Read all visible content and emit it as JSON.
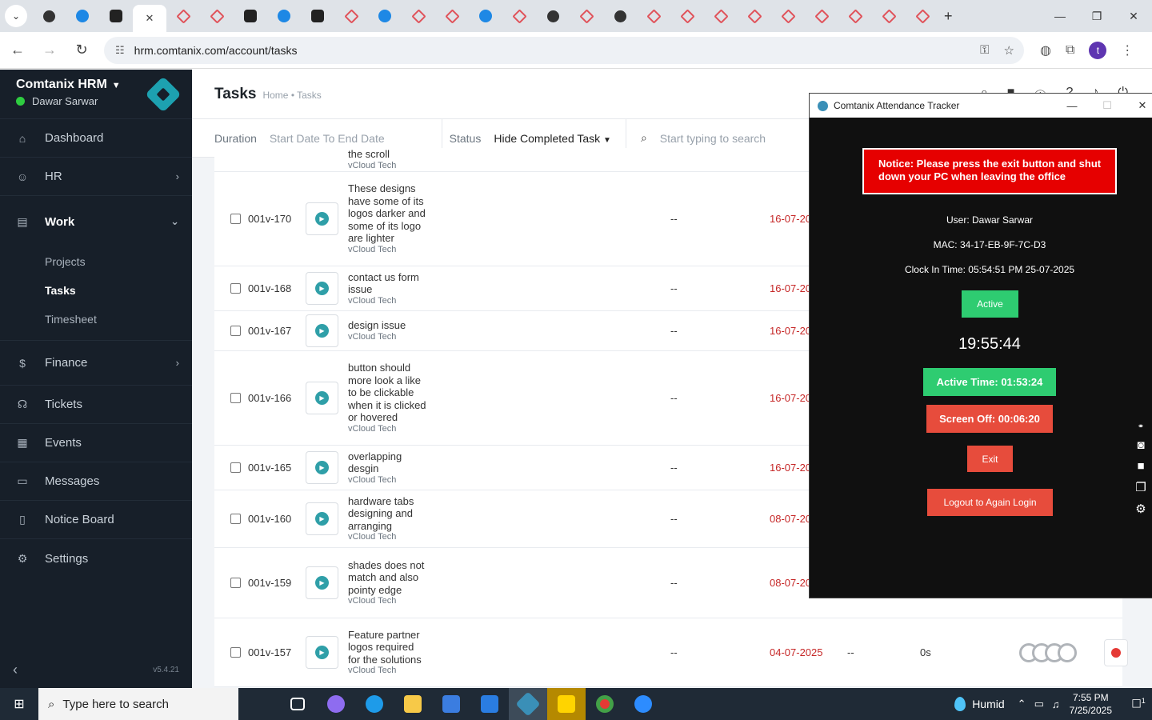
{
  "browser": {
    "url": "hrm.comtanix.com/account/tasks",
    "new_tab": "+",
    "profile_initial": "t"
  },
  "sidebar": {
    "brand": "Comtanix HRM",
    "user": "Dawar Sarwar",
    "version": "v5.4.21",
    "items": [
      {
        "label": "Dashboard"
      },
      {
        "label": "HR"
      },
      {
        "label": "Work"
      },
      {
        "label": "Finance"
      },
      {
        "label": "Tickets"
      },
      {
        "label": "Events"
      },
      {
        "label": "Messages"
      },
      {
        "label": "Notice Board"
      },
      {
        "label": "Settings"
      }
    ],
    "work_sub": [
      "Projects",
      "Tasks",
      "Timesheet"
    ]
  },
  "page": {
    "title": "Tasks",
    "breadcrumb": "Home • Tasks"
  },
  "filters": {
    "duration_label": "Duration",
    "duration_value": "Start Date To End Date",
    "status_label": "Status",
    "status_value": "Hide Completed Task",
    "search_placeholder": "Start typing to search"
  },
  "tasks": [
    {
      "id": "",
      "name": "the scroll",
      "client": "vCloud Tech",
      "h": 30,
      "partial": true
    },
    {
      "id": "001v-170",
      "name": "These designs have some of its logos darker and some of its logo are lighter",
      "client": "vCloud Tech",
      "dash": "--",
      "date": "16-07-20",
      "h": 118
    },
    {
      "id": "001v-168",
      "name": "contact us form issue",
      "client": "vCloud Tech",
      "dash": "--",
      "date": "16-07-20",
      "h": 56
    },
    {
      "id": "001v-167",
      "name": "design issue",
      "client": "vCloud Tech",
      "dash": "--",
      "date": "16-07-20",
      "h": 50
    },
    {
      "id": "001v-166",
      "name": "button should more look a like to be clickable when it is clicked or hovered",
      "client": "vCloud Tech",
      "dash": "--",
      "date": "16-07-20",
      "h": 118
    },
    {
      "id": "001v-165",
      "name": "overlapping desgin",
      "client": "vCloud Tech",
      "dash": "--",
      "date": "16-07-20",
      "h": 56
    },
    {
      "id": "001v-160",
      "name": "hardware tabs designing and arranging",
      "client": "vCloud Tech",
      "dash": "--",
      "date": "08-07-20",
      "h": 72
    },
    {
      "id": "001v-159",
      "name": "shades does not match and also pointy edge",
      "client": "vCloud Tech",
      "dash": "--",
      "date": "08-07-20",
      "h": 88
    },
    {
      "id": "001v-157",
      "name": "Feature partner logos required for the solutions",
      "client": "vCloud Tech",
      "dash": "--",
      "date": "04-07-2025",
      "dash2": "--",
      "time": "0s",
      "h": 86
    }
  ],
  "tracker": {
    "title": "Comtanix Attendance Tracker",
    "notice": "Notice: Please press the exit button and shut down your PC when leaving the office",
    "user": "User: Dawar Sarwar",
    "mac": "MAC: 34-17-EB-9F-7C-D3",
    "clock_in": "Clock In Time: 05:54:51 PM 25-07-2025",
    "status_btn": "Active",
    "clock": "19:55:44",
    "active_time": "Active Time: 01:53:24",
    "screen_off": "Screen Off: 00:06:20",
    "exit": "Exit",
    "logout": "Logout to Again Login"
  },
  "taskbar": {
    "search_placeholder": "Type here to search",
    "weather": "Humid",
    "time": "7:55 PM",
    "date": "7/25/2025",
    "notif_count": "1"
  }
}
